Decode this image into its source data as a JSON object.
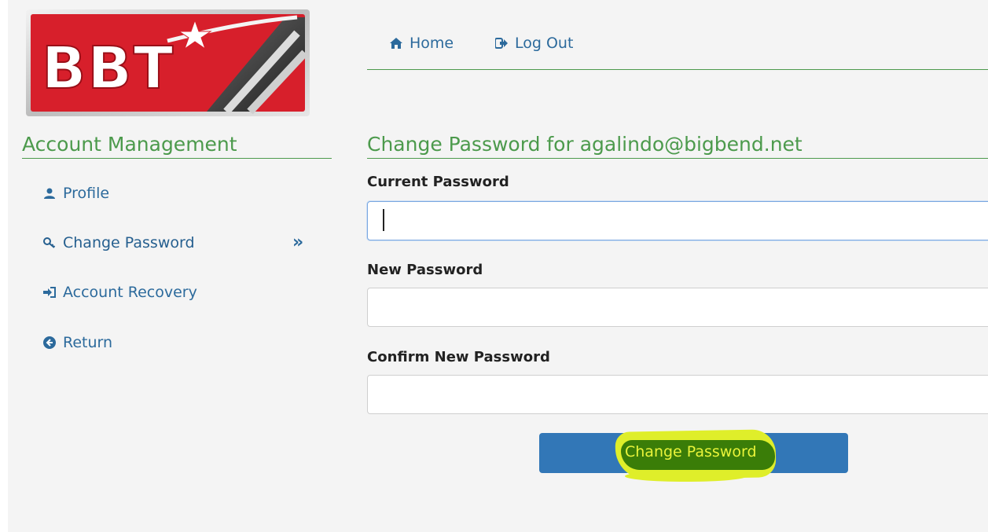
{
  "logo": {
    "text": "BBT"
  },
  "topnav": {
    "home_label": "Home",
    "home_icon": "home-icon",
    "logout_label": "Log Out",
    "logout_icon": "logout-icon"
  },
  "sidebar": {
    "title": "Account Management",
    "items": [
      {
        "label": "Profile",
        "icon": "user-icon"
      },
      {
        "label": "Change Password",
        "icon": "key-icon",
        "active": true
      },
      {
        "label": "Account Recovery",
        "icon": "sign-in-icon"
      },
      {
        "label": "Return",
        "icon": "arrow-circle-left-icon"
      }
    ],
    "active_indicator": "»"
  },
  "form": {
    "title": "Change Password for agalindo@bigbend.net",
    "current_label": "Current Password",
    "current_value": "",
    "new_label": "New Password",
    "new_value": "",
    "confirm_label": "Confirm New Password",
    "confirm_value": "",
    "submit_label": "Change Password"
  },
  "colors": {
    "accent_green": "#4c9a4c",
    "link_blue": "#2c6a9c",
    "button_blue": "#3277b7",
    "logo_red": "#d71f2b",
    "highlight_yellow": "#dfee2a"
  }
}
